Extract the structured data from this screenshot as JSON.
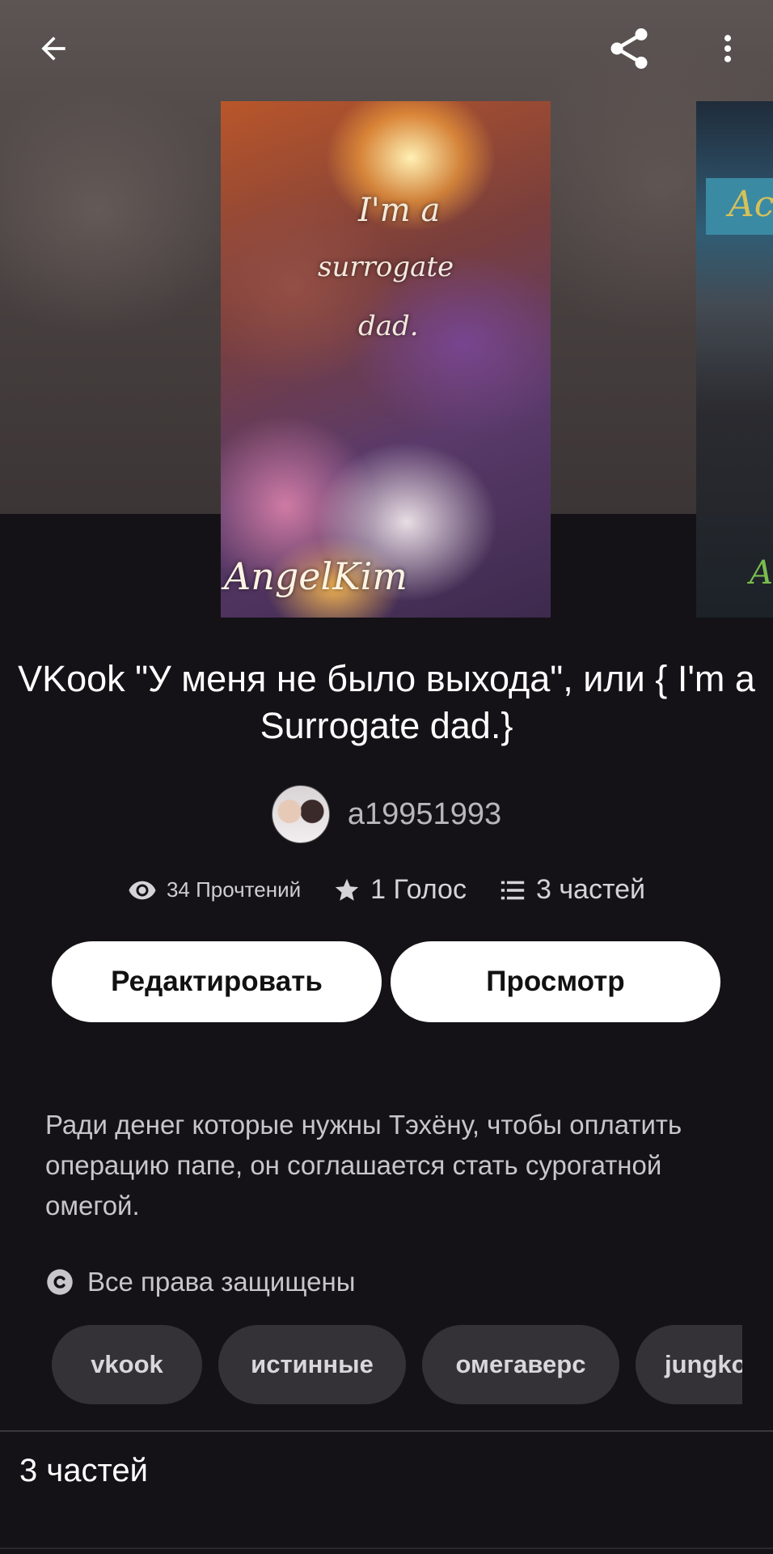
{
  "story": {
    "title": "VKook  \"У меня не было выхода\", или { I'm a Surrogate dad.}",
    "author": "a19951993",
    "cover": {
      "line1": "I'm a",
      "line2": "surrogate",
      "line3": "dad.",
      "signature": "AngelKim"
    },
    "next_cover": {
      "text_top": "Ac",
      "text_bottom": "An"
    }
  },
  "stats": {
    "reads": "34 Прочтений",
    "votes": "1 Голос",
    "parts": "3 частей"
  },
  "actions": {
    "edit_label": "Редактировать",
    "view_label": "Просмотр"
  },
  "description": "Ради денег которые нужны Тэхёну, чтобы оплатить операцию папе, он соглашается стать сурогатной омегой.",
  "copyright": "Все права защищены",
  "tags": [
    "vkook",
    "истинные",
    "омегаверс",
    "jungko"
  ],
  "parts_section": {
    "heading": "3 частей"
  },
  "icons": {
    "back": "arrow-left-icon",
    "share": "share-icon",
    "more": "more-vertical-icon",
    "reads": "eye-icon",
    "votes": "star-icon",
    "parts": "list-icon",
    "copyright": "copyright-icon"
  },
  "colors": {
    "background": "#141216",
    "button_bg": "#ffffff",
    "tag_bg": "#343236",
    "muted_text": "#c8c6ca"
  }
}
